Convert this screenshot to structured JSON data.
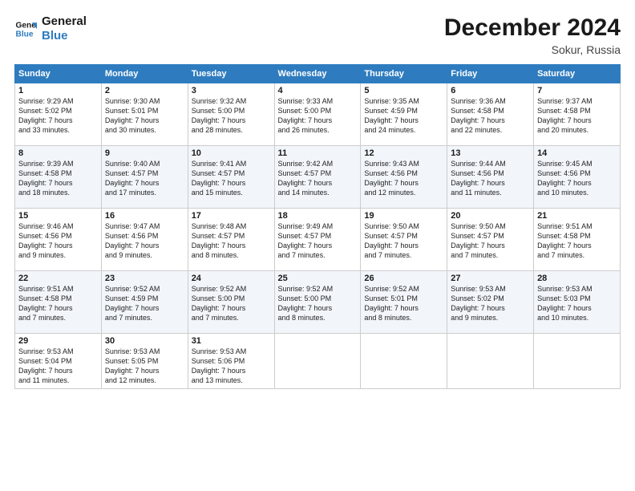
{
  "header": {
    "logo_line1": "General",
    "logo_line2": "Blue",
    "month": "December 2024",
    "location": "Sokur, Russia"
  },
  "weekdays": [
    "Sunday",
    "Monday",
    "Tuesday",
    "Wednesday",
    "Thursday",
    "Friday",
    "Saturday"
  ],
  "weeks": [
    [
      {
        "day": "1",
        "info": "Sunrise: 9:29 AM\nSunset: 5:02 PM\nDaylight: 7 hours\nand 33 minutes."
      },
      {
        "day": "2",
        "info": "Sunrise: 9:30 AM\nSunset: 5:01 PM\nDaylight: 7 hours\nand 30 minutes."
      },
      {
        "day": "3",
        "info": "Sunrise: 9:32 AM\nSunset: 5:00 PM\nDaylight: 7 hours\nand 28 minutes."
      },
      {
        "day": "4",
        "info": "Sunrise: 9:33 AM\nSunset: 5:00 PM\nDaylight: 7 hours\nand 26 minutes."
      },
      {
        "day": "5",
        "info": "Sunrise: 9:35 AM\nSunset: 4:59 PM\nDaylight: 7 hours\nand 24 minutes."
      },
      {
        "day": "6",
        "info": "Sunrise: 9:36 AM\nSunset: 4:58 PM\nDaylight: 7 hours\nand 22 minutes."
      },
      {
        "day": "7",
        "info": "Sunrise: 9:37 AM\nSunset: 4:58 PM\nDaylight: 7 hours\nand 20 minutes."
      }
    ],
    [
      {
        "day": "8",
        "info": "Sunrise: 9:39 AM\nSunset: 4:58 PM\nDaylight: 7 hours\nand 18 minutes."
      },
      {
        "day": "9",
        "info": "Sunrise: 9:40 AM\nSunset: 4:57 PM\nDaylight: 7 hours\nand 17 minutes."
      },
      {
        "day": "10",
        "info": "Sunrise: 9:41 AM\nSunset: 4:57 PM\nDaylight: 7 hours\nand 15 minutes."
      },
      {
        "day": "11",
        "info": "Sunrise: 9:42 AM\nSunset: 4:57 PM\nDaylight: 7 hours\nand 14 minutes."
      },
      {
        "day": "12",
        "info": "Sunrise: 9:43 AM\nSunset: 4:56 PM\nDaylight: 7 hours\nand 12 minutes."
      },
      {
        "day": "13",
        "info": "Sunrise: 9:44 AM\nSunset: 4:56 PM\nDaylight: 7 hours\nand 11 minutes."
      },
      {
        "day": "14",
        "info": "Sunrise: 9:45 AM\nSunset: 4:56 PM\nDaylight: 7 hours\nand 10 minutes."
      }
    ],
    [
      {
        "day": "15",
        "info": "Sunrise: 9:46 AM\nSunset: 4:56 PM\nDaylight: 7 hours\nand 9 minutes."
      },
      {
        "day": "16",
        "info": "Sunrise: 9:47 AM\nSunset: 4:56 PM\nDaylight: 7 hours\nand 9 minutes."
      },
      {
        "day": "17",
        "info": "Sunrise: 9:48 AM\nSunset: 4:57 PM\nDaylight: 7 hours\nand 8 minutes."
      },
      {
        "day": "18",
        "info": "Sunrise: 9:49 AM\nSunset: 4:57 PM\nDaylight: 7 hours\nand 7 minutes."
      },
      {
        "day": "19",
        "info": "Sunrise: 9:50 AM\nSunset: 4:57 PM\nDaylight: 7 hours\nand 7 minutes."
      },
      {
        "day": "20",
        "info": "Sunrise: 9:50 AM\nSunset: 4:57 PM\nDaylight: 7 hours\nand 7 minutes."
      },
      {
        "day": "21",
        "info": "Sunrise: 9:51 AM\nSunset: 4:58 PM\nDaylight: 7 hours\nand 7 minutes."
      }
    ],
    [
      {
        "day": "22",
        "info": "Sunrise: 9:51 AM\nSunset: 4:58 PM\nDaylight: 7 hours\nand 7 minutes."
      },
      {
        "day": "23",
        "info": "Sunrise: 9:52 AM\nSunset: 4:59 PM\nDaylight: 7 hours\nand 7 minutes."
      },
      {
        "day": "24",
        "info": "Sunrise: 9:52 AM\nSunset: 5:00 PM\nDaylight: 7 hours\nand 7 minutes."
      },
      {
        "day": "25",
        "info": "Sunrise: 9:52 AM\nSunset: 5:00 PM\nDaylight: 7 hours\nand 8 minutes."
      },
      {
        "day": "26",
        "info": "Sunrise: 9:52 AM\nSunset: 5:01 PM\nDaylight: 7 hours\nand 8 minutes."
      },
      {
        "day": "27",
        "info": "Sunrise: 9:53 AM\nSunset: 5:02 PM\nDaylight: 7 hours\nand 9 minutes."
      },
      {
        "day": "28",
        "info": "Sunrise: 9:53 AM\nSunset: 5:03 PM\nDaylight: 7 hours\nand 10 minutes."
      }
    ],
    [
      {
        "day": "29",
        "info": "Sunrise: 9:53 AM\nSunset: 5:04 PM\nDaylight: 7 hours\nand 11 minutes."
      },
      {
        "day": "30",
        "info": "Sunrise: 9:53 AM\nSunset: 5:05 PM\nDaylight: 7 hours\nand 12 minutes."
      },
      {
        "day": "31",
        "info": "Sunrise: 9:53 AM\nSunset: 5:06 PM\nDaylight: 7 hours\nand 13 minutes."
      },
      {
        "day": "",
        "info": ""
      },
      {
        "day": "",
        "info": ""
      },
      {
        "day": "",
        "info": ""
      },
      {
        "day": "",
        "info": ""
      }
    ]
  ]
}
